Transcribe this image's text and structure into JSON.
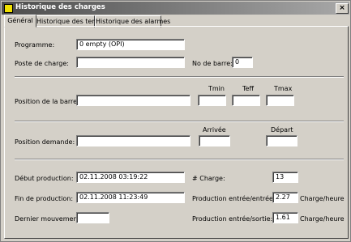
{
  "window": {
    "title": "Historique des charges",
    "close_glyph": "×"
  },
  "tabs": [
    "Général",
    "Historique des temps",
    "Historique des alarmes"
  ],
  "general": {
    "programme_label": "Programme:",
    "programme_value": "0 empty (OPI)",
    "poste_label": "Poste de charge:",
    "poste_value": "",
    "no_barre_label": "No de barre:",
    "no_barre_value": "0",
    "position_barre_label": "Position de la barre:",
    "position_barre_value": "",
    "tmin_label": "Tmin",
    "tmin_value": "",
    "teff_label": "Teff",
    "teff_value": "",
    "tmax_label": "Tmax",
    "tmax_value": "",
    "position_demande_label": "Position demande:",
    "position_demande_value": "",
    "arrivee_label": "Arrivée",
    "arrivee_value": "",
    "depart_label": "Départ",
    "depart_value": "",
    "debut_label": "Début production:",
    "debut_value": "02.11.2008 03:19:22",
    "fin_label": "Fin de production:",
    "fin_value": "02.11.2008 11:23:49",
    "dernier_label": "Dernier mouvement:",
    "dernier_value": "",
    "charge_label": "# Charge:",
    "charge_value": "13",
    "prod_ee_label": "Production entrée/entrée:",
    "prod_ee_value": "2.27",
    "prod_es_label": "Production entrée/sortie:",
    "prod_es_value": "1.61",
    "unit_label": "Charge/heure"
  },
  "colors": {
    "face": "#d4d0c8",
    "title_start": "#4d4d4d",
    "title_end": "#a8a8a8",
    "icon": "#f0e000"
  }
}
